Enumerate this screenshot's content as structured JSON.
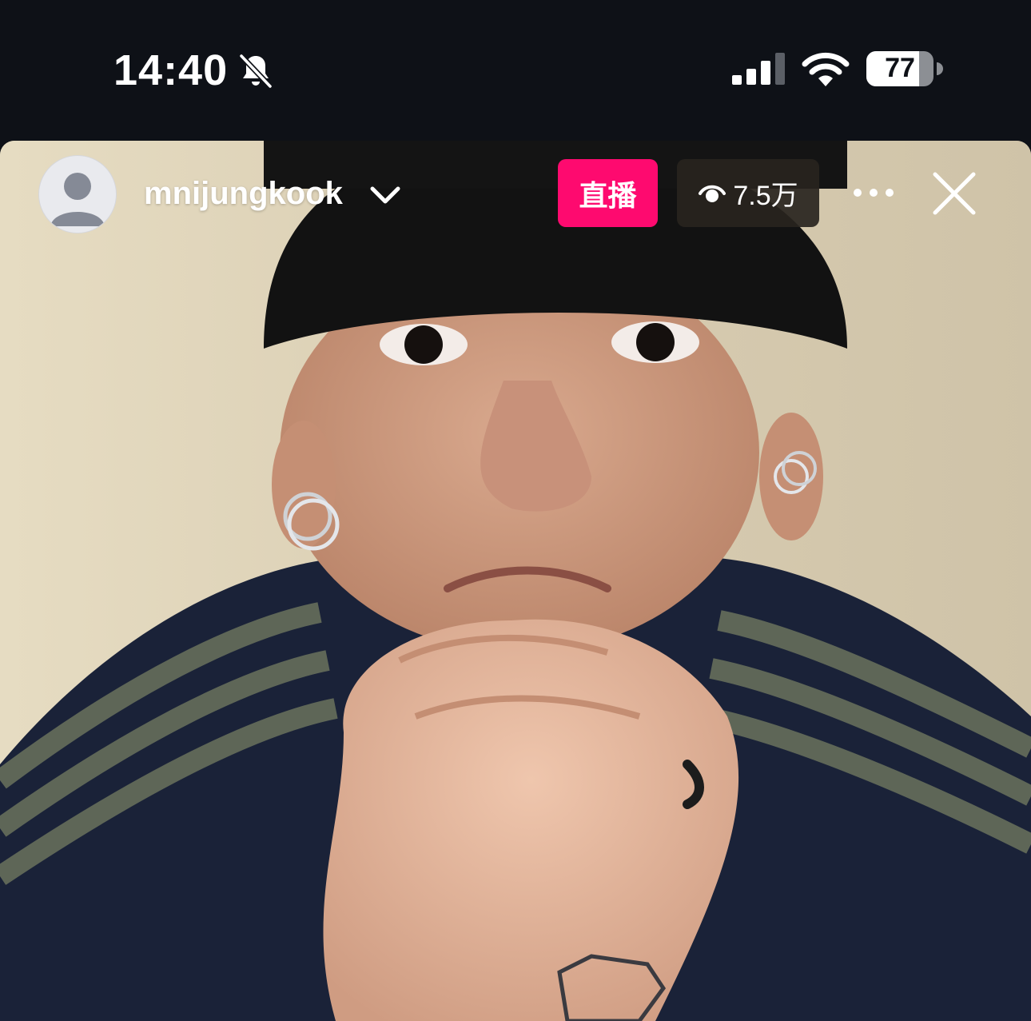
{
  "status_bar": {
    "time": "14:40",
    "battery_level": "77",
    "icons": [
      "bell-muted-icon",
      "signal-icon",
      "wifi-icon",
      "battery-icon"
    ]
  },
  "live": {
    "username": "mnijungkook",
    "live_label": "直播",
    "viewer_count": "7.5万",
    "accent_color": "#fe0a6f",
    "icons": [
      "avatar-placeholder-icon",
      "chevron-down-icon",
      "eye-icon",
      "more-icon",
      "close-icon"
    ]
  }
}
